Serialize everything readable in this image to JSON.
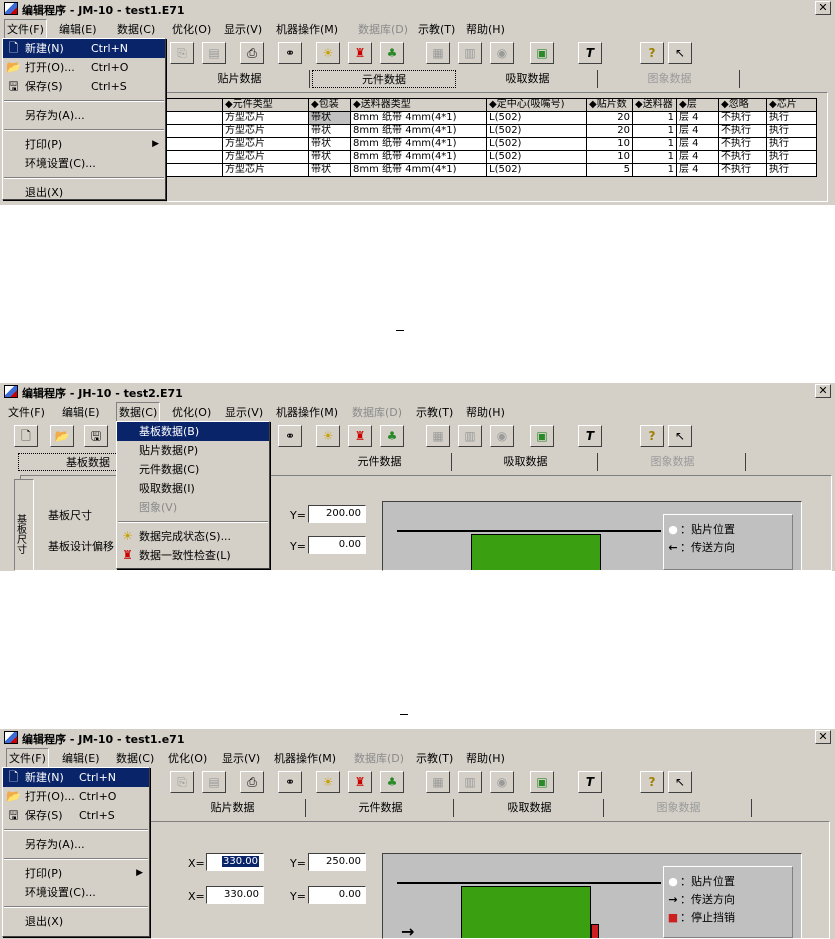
{
  "shot1": {
    "title": "编辑程序 - JM-10 - test1.E71",
    "menu": [
      "文件(F)",
      "编辑(E)",
      "数据(C)",
      "优化(O)",
      "显示(V)",
      "机器操作(M)",
      "数据库(D)",
      "示教(T)",
      "帮助(H)"
    ],
    "file_menu": {
      "new": "新建(N)",
      "new_sc": "Ctrl+N",
      "open": "打开(O)...",
      "open_sc": "Ctrl+O",
      "save": "保存(S)",
      "save_sc": "Ctrl+S",
      "save_as": "另存为(A)...",
      "print": "打印(P)",
      "env": "环境设置(C)...",
      "exit": "退出(X)"
    },
    "tabs": [
      "贴片数据",
      "元件数据",
      "吸取数据",
      "图象数据"
    ],
    "table": {
      "headers": [
        "元件类型",
        "包装",
        "送料器类型",
        "定中心(吸嘴号)",
        "贴片数",
        "送料器",
        "层",
        "忽略",
        "芯片"
      ],
      "rows": [
        [
          "方型芯片",
          "带状",
          "8mm 纸带  4mm(4*1)",
          "L(502)",
          "20",
          "1",
          "层 4",
          "不执行",
          "执行"
        ],
        [
          "方型芯片",
          "带状",
          "8mm 纸带  4mm(4*1)",
          "L(502)",
          "20",
          "1",
          "层 4",
          "不执行",
          "执行"
        ],
        [
          "方型芯片",
          "带状",
          "8mm 纸带  4mm(4*1)",
          "L(502)",
          "10",
          "1",
          "层 4",
          "不执行",
          "执行"
        ],
        [
          "方型芯片",
          "带状",
          "8mm 纸带  4mm(4*1)",
          "L(502)",
          "10",
          "1",
          "层 4",
          "不执行",
          "执行"
        ],
        [
          "方型芯片",
          "带状",
          "8mm 纸带  4mm(4*1)",
          "L(502)",
          "5",
          "1",
          "层 4",
          "不执行",
          "执行"
        ]
      ]
    }
  },
  "shot2": {
    "title": "编辑程序 - JH-10 - test2.E71",
    "menu": [
      "文件(F)",
      "编辑(E)",
      "数据(C)",
      "优化(O)",
      "显示(V)",
      "机器操作(M)",
      "数据库(D)",
      "示教(T)",
      "帮助(H)"
    ],
    "data_menu": {
      "board": "基板数据(B)",
      "placement": "贴片数据(P)",
      "component": "元件数据(C)",
      "pickup": "吸取数据(I)",
      "image": "图象(V)",
      "complete": "数据完成状态(S)...",
      "consistency": "数据一致性检查(L)"
    },
    "tabs": [
      "基板数据",
      "元件数据",
      "吸取数据",
      "图象数据"
    ],
    "side_label": "基板尺寸",
    "board_size_label": "基板尺寸",
    "board_design_label": "基板设计偏移",
    "y1_label": "Y=",
    "y1_value": "200.00",
    "y2_label": "Y=",
    "y2_value": "0.00",
    "legend": {
      "place": "：贴片位置",
      "dir": "：传送方向"
    }
  },
  "shot3": {
    "title": "编辑程序 - JM-10 - test1.e71",
    "menu": [
      "文件(F)",
      "编辑(E)",
      "数据(C)",
      "优化(O)",
      "显示(V)",
      "机器操作(M)",
      "数据库(D)",
      "示教(T)",
      "帮助(H)"
    ],
    "file_menu": {
      "new": "新建(N)",
      "new_sc": "Ctrl+N",
      "open": "打开(O)...",
      "open_sc": "Ctrl+O",
      "save": "保存(S)",
      "save_sc": "Ctrl+S",
      "save_as": "另存为(A)...",
      "print": "打印(P)",
      "env": "环境设置(C)...",
      "exit": "退出(X)"
    },
    "tabs": [
      "贴片数据",
      "元件数据",
      "吸取数据",
      "图象数据"
    ],
    "x1_label": "X=",
    "x1_value": "330.00",
    "y1_label": "Y=",
    "y1_value": "250.00",
    "x2_label": "X=",
    "x2_value": "330.00",
    "y2_label": "Y=",
    "y2_value": "0.00",
    "legend": {
      "place": "：贴片位置",
      "dir": "：传送方向",
      "stop": "：停止挡销"
    }
  },
  "colors": {
    "menu_highlight": "#0a246a",
    "board_green": "#3aa012",
    "window_face": "#d4d0c8",
    "stopper_red": "#cc2020"
  }
}
